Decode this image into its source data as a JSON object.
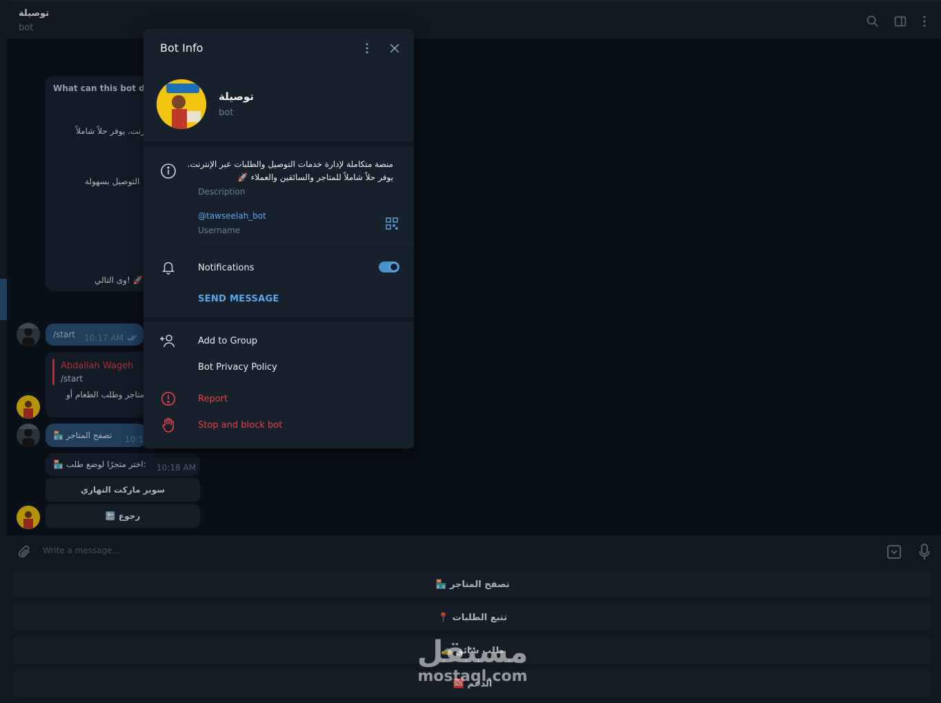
{
  "header": {
    "chat_title": "توصيلة",
    "chat_subtitle": "bot"
  },
  "messages": {
    "intro_heading": "What can this bot do?",
    "intro_line1": "رنت. يوفر حلاً شاملاً",
    "intro_line2": "التوصيل بسهولة",
    "intro_line3": "وى التالي! 🚀",
    "start_text": "/start",
    "start_time": "10:17 AM",
    "reply_author": "Abdallah Wageh",
    "reply_quote": "/start",
    "reply_text": "متاجر وطلب الطعام أو",
    "browse_text": "🏪 تصفح المتاجر",
    "browse_time": "10:18",
    "choose_text": "🏪 اختر متجرًا لوضع طلب:",
    "choose_time": "10:18 AM",
    "inline_btn_1": "سوبر ماركت النهاري",
    "inline_btn_2": "🔙 رجوع"
  },
  "input": {
    "placeholder": "Write a message..."
  },
  "keyboard": {
    "btn_1": "🏪 تصفح المتاجر",
    "btn_2": "📍 تتبع الطلبات",
    "btn_3": "🚕 طلب سائق",
    "btn_4": "🆘 الدعم"
  },
  "modal": {
    "title": "Bot Info",
    "bot_name": "توصيلة",
    "bot_type": "bot",
    "description": "منصة متكاملة لإدارة خدمات التوصيل والطلبات عبر الإنترنت. يوفر حلاً شاملاً للمتاجر والسائقين والعملاء 🚀",
    "description_label": "Description",
    "username": "@tawseelah_bot",
    "username_label": "Username",
    "notifications_label": "Notifications",
    "notifications_on": true,
    "send_message": "SEND MESSAGE",
    "add_to_group": "Add to Group",
    "privacy_policy": "Bot Privacy Policy",
    "report": "Report",
    "stop_block": "Stop and block bot"
  },
  "watermark": {
    "line1": "مستقل",
    "line2": "mostaql.com"
  },
  "colors": {
    "background": "#0e1621",
    "panel": "#17212b",
    "accent": "#5ba7e8",
    "danger": "#e5414b",
    "outgoing": "#2b5278"
  }
}
